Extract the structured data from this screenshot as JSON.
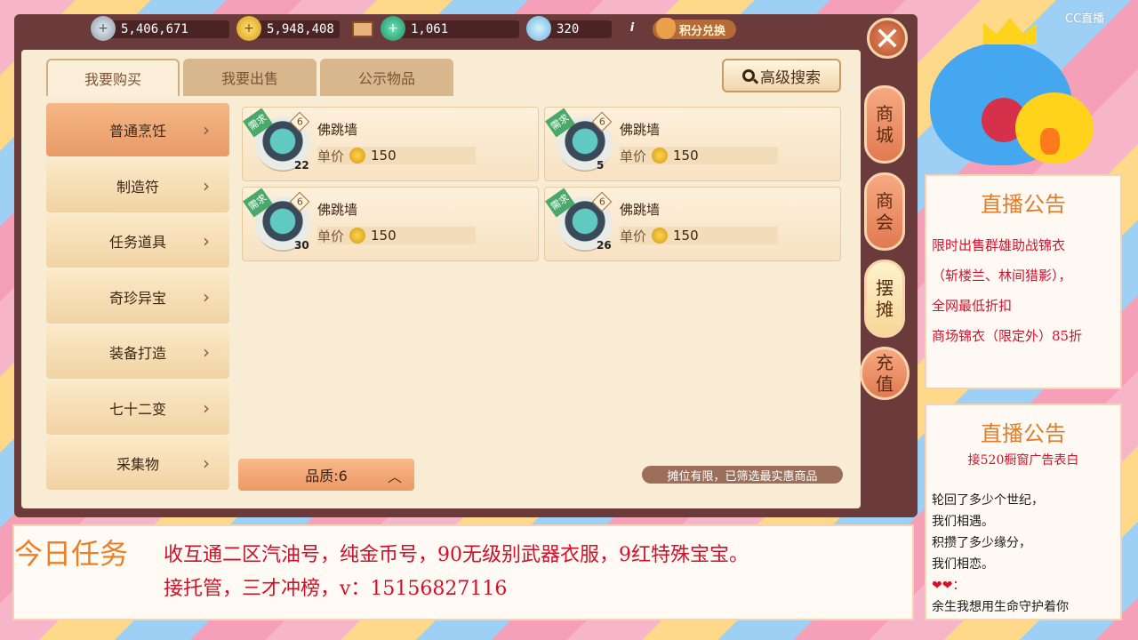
{
  "currency": {
    "silver": "5,406,671",
    "gold": "5,948,408",
    "jade": "1,061",
    "cloud": "320",
    "points_label": "积分兑换"
  },
  "tabs": [
    "我要购买",
    "我要出售",
    "公示物品"
  ],
  "search_label": "高级搜索",
  "categories": [
    "普通烹饪",
    "制造符",
    "任务道具",
    "奇珍异宝",
    "装备打造",
    "七十二变",
    "采集物"
  ],
  "items": [
    {
      "name": "佛跳墙",
      "price_label": "单价",
      "price": "150",
      "quantity": "22",
      "quality": "6",
      "tag": "需求"
    },
    {
      "name": "佛跳墙",
      "price_label": "单价",
      "price": "150",
      "quantity": "5",
      "quality": "6",
      "tag": "需求"
    },
    {
      "name": "佛跳墙",
      "price_label": "单价",
      "price": "150",
      "quantity": "30",
      "quality": "6",
      "tag": "需求"
    },
    {
      "name": "佛跳墙",
      "price_label": "单价",
      "price": "150",
      "quantity": "26",
      "quality": "6",
      "tag": "需求"
    }
  ],
  "quality_filter": "品质:6",
  "notice": "摊位有限，已筛选最实惠商品",
  "side_tabs": [
    {
      "top": "商",
      "bottom": "城"
    },
    {
      "top": "商",
      "bottom": "会"
    },
    {
      "top": "摆",
      "bottom": "摊"
    },
    {
      "top": "充",
      "bottom": "值"
    }
  ],
  "announce1": {
    "title": "直播公告",
    "lines": [
      "限时出售群雄助战锦衣",
      "（斩楼兰、林间猎影），",
      "全网最低折扣",
      "商场锦衣（限定外）85折"
    ]
  },
  "announce2": {
    "title": "直播公告",
    "subtitle": "接520橱窗广告表白",
    "lines": [
      "轮回了多少个世纪，",
      "我们相遇。",
      "积攒了多少缘分，",
      "我们相恋。",
      "❤❤：",
      "余生我想用生命守护着你"
    ]
  },
  "task": {
    "label": "今日任务",
    "line1": "收互通二区汽油号，纯金币号，90无级别武器衣服，9红特殊宝宝。",
    "line2": "接托管，三才冲榜，v：15156827116"
  },
  "logo": "CC直播"
}
